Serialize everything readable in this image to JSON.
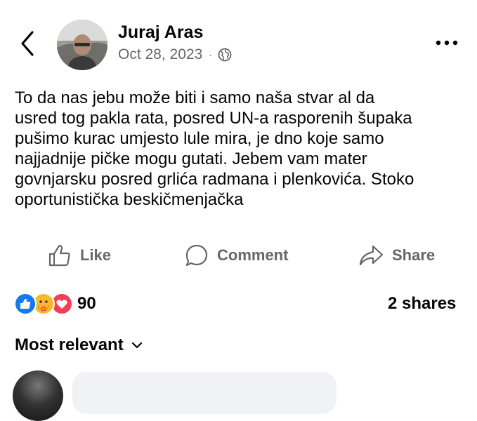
{
  "post": {
    "author": "Juraj Aras",
    "date": "Oct 28, 2023",
    "separator": "·",
    "privacy_icon": "globe-icon",
    "text_lines": [
      "To da nas jebu može biti i samo naša stvar al da",
      "usred tog pakla rata, posred UN-a rasporenih šupaka",
      "pušimo kurac umjesto lule mira, je dno koje samo",
      "najjadnije pičke mogu gutati. Jebem vam mater",
      "govnjarsku posred grlića radmana i plenkovića. Stoko",
      "oportunistička beskičmenjačka"
    ]
  },
  "header": {
    "back_icon": "chevron-left-icon",
    "more_icon": "more-horizontal-icon"
  },
  "actions": {
    "like_label": "Like",
    "comment_label": "Comment",
    "share_label": "Share"
  },
  "engagement": {
    "reaction_count": "90",
    "reaction_types": [
      "like",
      "care",
      "love"
    ],
    "shares_label": "2 shares"
  },
  "comments": {
    "sort_label": "Most relevant"
  },
  "colors": {
    "like_blue": "#1877f2",
    "care_yellow": "#f7b928",
    "love_red": "#f33e58",
    "secondary_text": "#65676b"
  }
}
